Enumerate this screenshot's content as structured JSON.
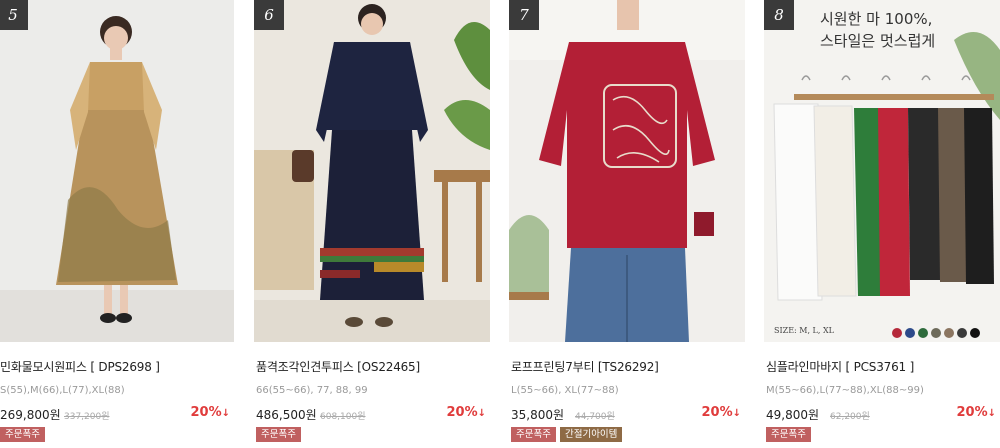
{
  "products": [
    {
      "number": "5",
      "name": "민화물모시원피스 [ DPS2698 ]",
      "sizes": "S(55),M(66),L(77),XL(88)",
      "price": "269,800원",
      "original_price": "337,200원",
      "discount": "20%",
      "discount_arrow": "↓",
      "badges": [
        "주문폭주"
      ]
    },
    {
      "number": "6",
      "name": "품격조각인견투피스 [OS22465]",
      "sizes": "66(55~66), 77, 88, 99",
      "price": "486,500원",
      "original_price": "608,100원",
      "discount": "20%",
      "discount_arrow": "↓",
      "badges": [
        "주문폭주"
      ]
    },
    {
      "number": "7",
      "name": "로프프린팅7부티 [TS26292]",
      "sizes": "L(55~66), XL(77~88)",
      "price": "35,800원",
      "original_price": "44,700원",
      "discount": "20%",
      "discount_arrow": "↓",
      "badges": [
        "주문폭주",
        "간절기아이템"
      ]
    },
    {
      "number": "8",
      "name": "심플라인마바지 [ PCS3761 ]",
      "sizes": "M(55~66),L(77~88),XL(88~99)",
      "price": "49,800원",
      "original_price": "62,200원",
      "discount": "20%",
      "discount_arrow": "↓",
      "badges": [
        "주문폭주"
      ],
      "promo_line1": "시원한 마 100%,",
      "promo_line2": "스타일은 멋스럽게",
      "size_caption": "SIZE: M, L, XL",
      "swatch_colors": [
        "#b5283a",
        "#2d4a8a",
        "#2e6b3c",
        "#6d6a5a",
        "#8b7560",
        "#3a3a3a",
        "#111111"
      ]
    }
  ],
  "colors": {
    "discount": "#e03c3c",
    "badge_red": "#c06060",
    "badge_brown": "#8e6a45"
  }
}
